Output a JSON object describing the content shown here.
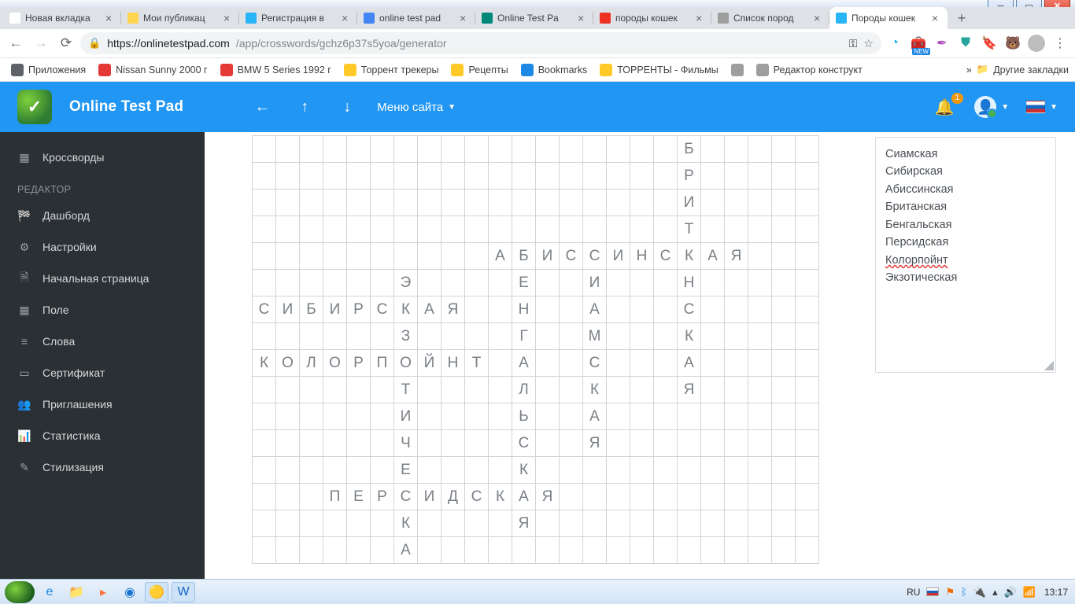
{
  "browser": {
    "tabs": [
      {
        "label": "Новая вкладка",
        "fav": "#ffffff"
      },
      {
        "label": "Мои публикац",
        "fav": "#ffd54f"
      },
      {
        "label": "Регистрация в",
        "fav": "#29b6f6"
      },
      {
        "label": "online test pad",
        "fav": "#4285f4"
      },
      {
        "label": "Online Test Pa",
        "fav": "#00897b"
      },
      {
        "label": "породы кошек",
        "fav": "#ef3124"
      },
      {
        "label": "Список пород",
        "fav": "#9e9e9e"
      },
      {
        "label": "Породы кошек",
        "fav": "#29b6f6",
        "active": true
      }
    ],
    "url_host": "https://onlinetestpad.com",
    "url_path": "/app/crosswords/gchz6p37s5yoa/generator",
    "bookmarks": [
      {
        "label": "Приложения",
        "ico": "#5f6368"
      },
      {
        "label": "Nissan Sunny 2000 г",
        "ico": "#e53935"
      },
      {
        "label": "BMW 5 Series 1992 г",
        "ico": "#e53935"
      },
      {
        "label": "Торрент трекеры",
        "ico": "#ffca28"
      },
      {
        "label": "Рецепты",
        "ico": "#ffca28"
      },
      {
        "label": "Bookmarks",
        "ico": "#1e88e5"
      },
      {
        "label": "ТОРРЕНТЫ - Фильмы",
        "ico": "#ffca28"
      },
      {
        "label": "",
        "ico": "#9e9e9e"
      },
      {
        "label": "Редактор конструкт",
        "ico": "#9e9e9e"
      }
    ],
    "bookmarks_overflow": "Другие закладки"
  },
  "app": {
    "brand": "Online Test Pad",
    "menu_site": "Меню сайта",
    "notify_badge": "1",
    "sidebar": {
      "top": [
        {
          "icon": "▦",
          "label": "Кроссворды"
        }
      ],
      "heading": "РЕДАКТОР",
      "items": [
        {
          "icon": "🏁",
          "label": "Дашборд"
        },
        {
          "icon": "⚙",
          "label": "Настройки"
        },
        {
          "icon": "🗎",
          "label": "Начальная страница"
        },
        {
          "icon": "▦",
          "label": "Поле"
        },
        {
          "icon": "≡",
          "label": "Слова"
        },
        {
          "icon": "▭",
          "label": "Сертификат"
        },
        {
          "icon": "👥",
          "label": "Приглашения"
        },
        {
          "icon": "📊",
          "label": "Статистика"
        },
        {
          "icon": "✎",
          "label": "Стилизация"
        }
      ]
    }
  },
  "crossword": {
    "cols": 24,
    "rows": 16,
    "entries": [
      {
        "word": "БРИТАНСКАЯ",
        "row": 0,
        "col": 18,
        "dir": "V"
      },
      {
        "word": "АБИССИНСКАЯ",
        "row": 4,
        "col": 10,
        "dir": "H"
      },
      {
        "word": "СИБИРСКАЯ",
        "row": 6,
        "col": 0,
        "dir": "H"
      },
      {
        "word": "ЭКЗОТИЧЕСКА",
        "row": 5,
        "col": 6,
        "dir": "V"
      },
      {
        "word": "БЕНГАЛЬСКАЯ",
        "row": 4,
        "col": 11,
        "dir": "V"
      },
      {
        "word": "СИАМСКАЯ",
        "row": 4,
        "col": 14,
        "dir": "V"
      },
      {
        "word": "КОЛОРПОЙНТ",
        "row": 8,
        "col": 0,
        "dir": "H"
      },
      {
        "word": "ПЕРСИДСКАЯ",
        "row": 13,
        "col": 3,
        "dir": "H"
      }
    ],
    "word_list": [
      "Сиамская",
      "Сибирская",
      "Абиссинская",
      "Британская",
      "Бенгальская",
      "Персидская",
      "Колорпойнт",
      "Экзотическая"
    ],
    "misspelled_index": 6
  },
  "taskbar": {
    "lang": "RU",
    "time": "13:17"
  }
}
